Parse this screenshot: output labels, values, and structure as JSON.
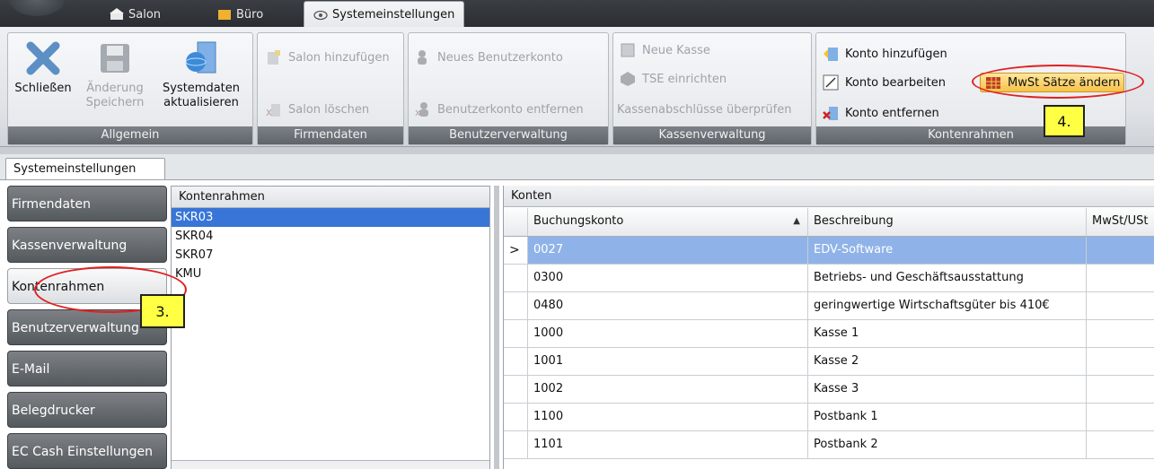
{
  "top_tabs": [
    {
      "label": "Salon",
      "icon": "salon-icon"
    },
    {
      "label": "Büro",
      "icon": "buero-icon"
    },
    {
      "label": "Systemeinstellungen",
      "icon": "eye-settings-icon"
    }
  ],
  "ribbon": {
    "allgemein": {
      "label": "Allgemein",
      "close": "Schließen",
      "save_line1": "Änderung",
      "save_line2": "Speichern",
      "refresh_line1": "Systemdaten",
      "refresh_line2": "aktualisieren"
    },
    "firmendaten": {
      "label": "Firmendaten",
      "add": "Salon hinzufügen",
      "delete": "Salon löschen"
    },
    "benutzer": {
      "label": "Benutzerverwaltung",
      "add": "Neues Benutzerkonto",
      "remove": "Benutzerkonto entfernen"
    },
    "kasse": {
      "label": "Kassenverwaltung",
      "new": "Neue Kasse",
      "tse": "TSE einrichten",
      "check": "Kassenabschlüsse überprüfen"
    },
    "kontenrahmen": {
      "label": "Kontenrahmen",
      "add": "Konto hinzufügen",
      "edit": "Konto bearbeiten",
      "mwst": "MwSt Sätze ändern",
      "remove": "Konto entfernen"
    }
  },
  "annotations": {
    "step3": "3.",
    "step4": "4."
  },
  "settings_tab": "Systemeinstellungen",
  "nav": [
    "Firmendaten",
    "Kassenverwaltung",
    "Kontenrahmen",
    "Benutzerverwaltung",
    "E-Mail",
    "Belegdrucker",
    "EC Cash Einstellungen"
  ],
  "nav_selected": "Kontenrahmen",
  "kontenrahmen": {
    "header": "Kontenrahmen",
    "items": [
      "SKR03",
      "SKR04",
      "SKR07",
      "KMU"
    ],
    "selected": "SKR03"
  },
  "konten": {
    "header": "Konten",
    "columns": [
      "Buchungskonto",
      "Beschreibung",
      "MwSt/USt"
    ],
    "rows": [
      [
        "0027",
        "EDV-Software",
        ""
      ],
      [
        "0300",
        "Betriebs- und Geschäftsausstattung",
        ""
      ],
      [
        "0480",
        "geringwertige Wirtschaftsgüter bis 410€",
        ""
      ],
      [
        "1000",
        "Kasse 1",
        ""
      ],
      [
        "1001",
        "Kasse 2",
        ""
      ],
      [
        "1002",
        "Kasse 3",
        ""
      ],
      [
        "1100",
        "Postbank 1",
        ""
      ],
      [
        "1101",
        "Postbank 2",
        ""
      ]
    ],
    "selected_row": 0,
    "current_row_marker": ">",
    "sort_indicator": "▲"
  },
  "colors": {
    "selection": "#3875d7",
    "annotation_red": "#e02020",
    "callout_yellow": "#ffff44"
  }
}
